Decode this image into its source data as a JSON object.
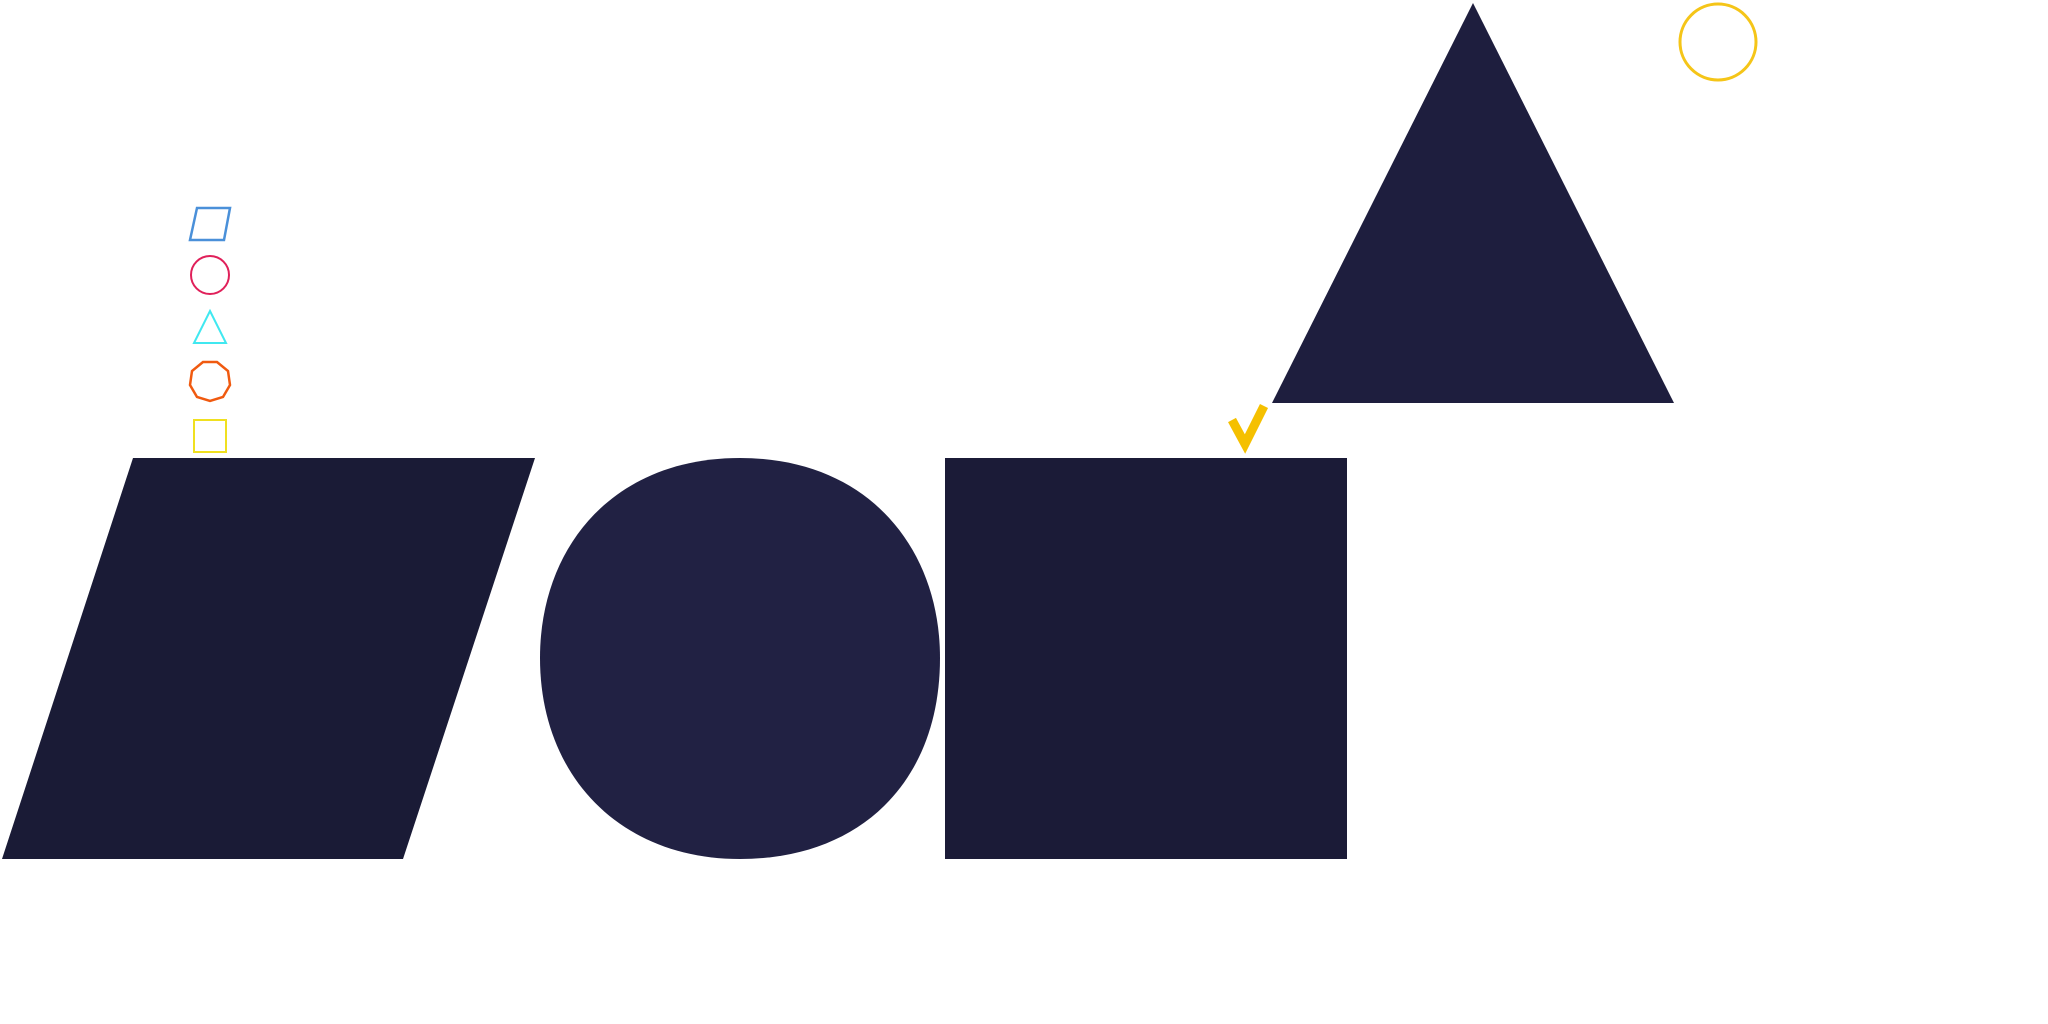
{
  "colors": {
    "background": "#ffffff",
    "parallelogram_fill": "#1a1b36",
    "circle_fill": "#212143",
    "square_fill": "#1b1b37",
    "triangle_fill": "#1e1e3e",
    "checkmark": "#f5c000",
    "target_circle_stroke": "#f5c518",
    "legend_parallelogram": "#4a90d9",
    "legend_circle": "#e0205a",
    "legend_triangle": "#40e8f0",
    "legend_octagon": "#f05a10",
    "legend_square": "#f0e020"
  },
  "legend": [
    {
      "shape": "parallelogram",
      "icon": "parallelogram-outline-icon"
    },
    {
      "shape": "circle",
      "icon": "circle-outline-icon"
    },
    {
      "shape": "triangle",
      "icon": "triangle-outline-icon"
    },
    {
      "shape": "octagon",
      "icon": "octagon-outline-icon"
    },
    {
      "shape": "square",
      "icon": "square-outline-icon"
    }
  ],
  "shapes": [
    {
      "shape": "parallelogram"
    },
    {
      "shape": "circle"
    },
    {
      "shape": "square"
    },
    {
      "shape": "triangle"
    }
  ],
  "markers": {
    "checkmark_icon": "checkmark-icon",
    "target_icon": "circle-outline-icon"
  }
}
